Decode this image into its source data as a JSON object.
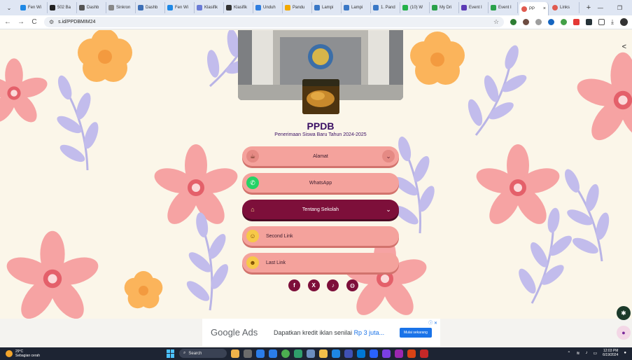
{
  "browser": {
    "tabs": [
      {
        "label": "Fen Wi",
        "color": "#1e88e5"
      },
      {
        "label": "502 Ba",
        "color": "#222222"
      },
      {
        "label": "Dashb",
        "color": "#555555"
      },
      {
        "label": "Sinkron",
        "color": "#888888"
      },
      {
        "label": "Dashb",
        "color": "#3d6fb6"
      },
      {
        "label": "Fen Wi",
        "color": "#1e88e5"
      },
      {
        "label": "Klasifik",
        "color": "#6a7bd6"
      },
      {
        "label": "Klasifik",
        "color": "#333333"
      },
      {
        "label": "Unduh",
        "color": "#2f7ee0"
      },
      {
        "label": "Pandu",
        "color": "#f2a900"
      },
      {
        "label": "Lampi",
        "color": "#3a78c6"
      },
      {
        "label": "Lampi",
        "color": "#3a78c6"
      },
      {
        "label": "1. Pand",
        "color": "#3a78c6"
      },
      {
        "label": "(10) W",
        "color": "#25b14a"
      },
      {
        "label": "My Dri",
        "color": "#2aa14a"
      },
      {
        "label": "Event I",
        "color": "#5c3bb5"
      },
      {
        "label": "Event I",
        "color": "#2aa14a"
      }
    ],
    "active_tab": {
      "label": "PP",
      "close": "×"
    },
    "extra_tab": {
      "label": "Links"
    },
    "new_tab": "+",
    "url": "s.id/PPDBMIM24",
    "window_controls": {
      "minimize": "—",
      "maximize": "❐"
    },
    "nav": {
      "back": "←",
      "forward": "→",
      "reload": "C"
    }
  },
  "page": {
    "title": "PPDB",
    "subtitle": "Penerimaan Siswa Baru Tahun 2024-2025",
    "links": [
      {
        "label": "Alamat",
        "icon": "coffee-cup-icon",
        "glyph": "☕",
        "has_chevron": true,
        "dark": false
      },
      {
        "label": "WhatsApp",
        "icon": "whatsapp-icon",
        "glyph": "✆",
        "has_chevron": false,
        "dark": false
      },
      {
        "label": "Tentang Sekolah",
        "icon": "school-icon",
        "glyph": "⌂",
        "has_chevron": true,
        "dark": true
      },
      {
        "label": "Second Link",
        "icon": "smile-emoji-icon",
        "glyph": "☺",
        "has_chevron": false,
        "dark": false
      },
      {
        "label": "Last Link",
        "icon": "sunglasses-emoji-icon",
        "glyph": "☻",
        "has_chevron": false,
        "dark": false
      }
    ],
    "chevron": "⌄",
    "socials": [
      {
        "name": "facebook-icon",
        "glyph": "f"
      },
      {
        "name": "x-twitter-icon",
        "glyph": "X"
      },
      {
        "name": "tiktok-icon",
        "glyph": "♪"
      },
      {
        "name": "globe-icon",
        "glyph": "◍"
      }
    ],
    "share_glyph": "<"
  },
  "ad": {
    "brand": "Google Ads",
    "text_prefix": "Dapatkan kredit iklan senilai ",
    "text_highlight": "Rp 3 juta...",
    "button": "Mulai sekarang",
    "close": "ⓘ ✕"
  },
  "taskbar": {
    "weather_temp": "29°C",
    "weather_desc": "Sebagian cerah",
    "search_label": "Search",
    "time": "12:03 PM",
    "date": "6/19/2024"
  },
  "colors": {
    "accent_dark": "#7d0f3a",
    "link_pink": "#f4a29c",
    "title_purple": "#3a0f63",
    "background": "#fbf6e9"
  }
}
